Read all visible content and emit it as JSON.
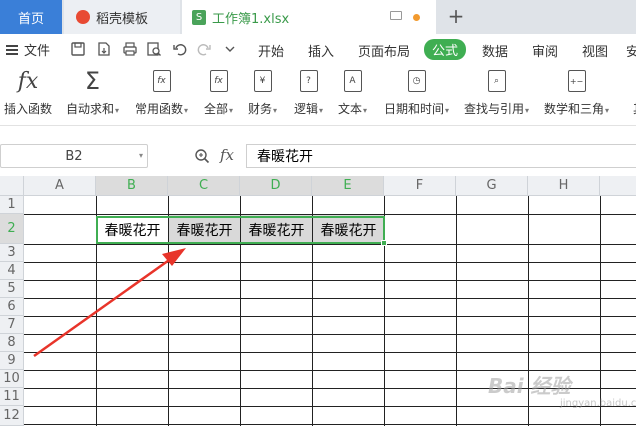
{
  "tabs": {
    "home": "首页",
    "docer": "稻壳模板",
    "workbook": "工作簿1.xlsx",
    "workbook_icon": "S",
    "add": "+"
  },
  "menu": {
    "file": "文件",
    "items": [
      "开始",
      "插入",
      "页面布局",
      "公式",
      "数据",
      "审阅",
      "视图",
      "安"
    ],
    "active_color": "#3fae52"
  },
  "ribbon": {
    "buttons": [
      {
        "label": "插入函数",
        "icon": "fx-icon"
      },
      {
        "label": "自动求和",
        "icon": "sigma-icon"
      },
      {
        "label": "常用函数",
        "icon": "fx-doc-icon"
      },
      {
        "label": "全部",
        "icon": "fx-box-icon"
      },
      {
        "label": "财务",
        "icon": "yen-book-icon"
      },
      {
        "label": "逻辑",
        "icon": "question-doc-icon"
      },
      {
        "label": "文本",
        "icon": "text-doc-icon"
      },
      {
        "label": "日期和时间",
        "icon": "clock-doc-icon"
      },
      {
        "label": "查找与引用",
        "icon": "search-doc-icon"
      },
      {
        "label": "数学和三角",
        "icon": "math-doc-icon"
      },
      {
        "label": "其",
        "icon": "more-icon"
      }
    ]
  },
  "formula_bar": {
    "name_box": "B2",
    "fx": "fx",
    "content": "春暖花开"
  },
  "grid": {
    "columns": [
      "A",
      "B",
      "C",
      "D",
      "E",
      "F",
      "G",
      "H"
    ],
    "rows": [
      "1",
      "2",
      "3",
      "4",
      "5",
      "6",
      "7",
      "8",
      "9",
      "10",
      "11",
      "12"
    ],
    "cells": {
      "B2": "春暖花开",
      "C2": "春暖花开",
      "D2": "春暖花开",
      "E2": "春暖花开"
    },
    "selection_color": "#3fae52"
  },
  "watermark": {
    "text": "Bai 经验",
    "sub": "jingyan.baidu.com"
  }
}
